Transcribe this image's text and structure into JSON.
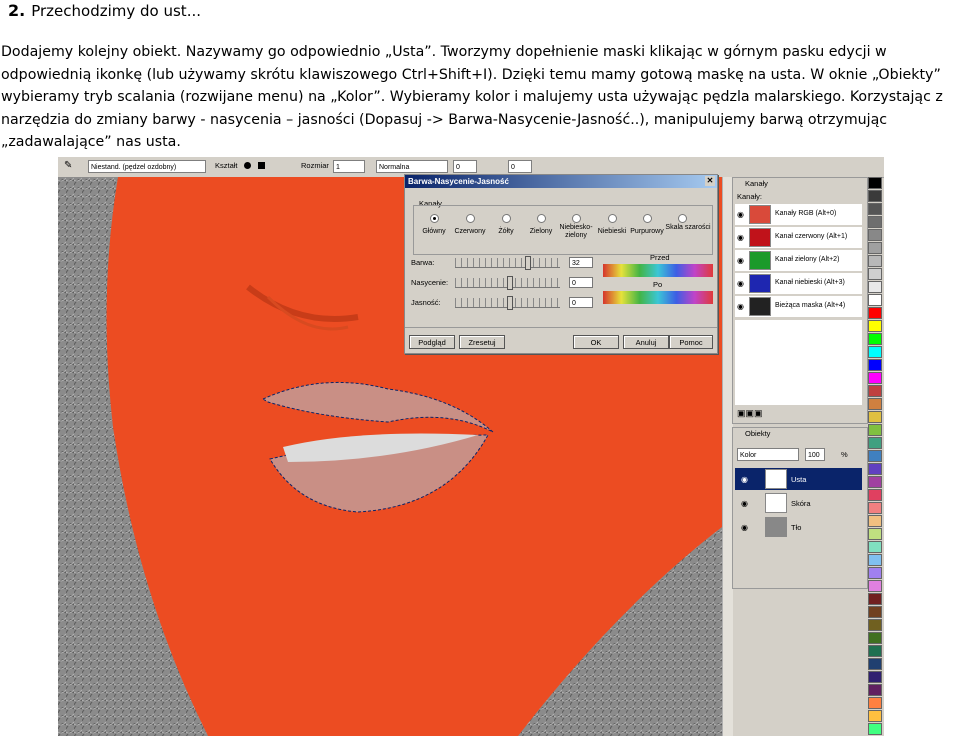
{
  "heading": {
    "number": "2.",
    "text": "Przechodzimy do ust..."
  },
  "paragraph_lines": [
    "Dodajemy kolejny obiekt. Nazywamy go odpowiednio „Usta”. Tworzymy dopełnienie maski klikając w górnym pasku edycji w",
    "odpowiednią ikonkę (lub używamy skrótu klawiszowego Ctrl+Shift+I). Dzięki temu mamy gotową maskę na usta. W oknie „Obiekty”",
    "wybieramy tryb scalania (rozwijane menu) na „Kolor”. Wybieramy kolor i malujemy usta używając pędzla malarskiego. Korzystając z",
    "narzędzia do zmiany barwy - nasycenia – jasności (Dopasuj -> Barwa-Nasycenie-Jasność..), manipulujemy barwą otrzymując",
    "„zadawalające” nas usta."
  ],
  "toolbar": {
    "brush": "Niestand. (pędzel ozdobny)",
    "shape_label": "Kształt",
    "size_label": "Rozmiar",
    "size_value": "1",
    "blend_mode": "Normalna",
    "value_a": "0",
    "value_b": "0"
  },
  "dialog": {
    "title": "Barwa-Nasycenie-Jasność",
    "group_label": "Kanały",
    "channels": [
      "Główny",
      "Czerwony",
      "Żółty",
      "Zielony",
      "Niebiesko-zielony",
      "Niebieski",
      "Purpurowy",
      "Skala szarości"
    ],
    "selected_channel": "Główny",
    "hue_label": "Barwa:",
    "hue_value": "32",
    "sat_label": "Nasycenie:",
    "sat_value": "0",
    "light_label": "Jasność:",
    "light_value": "0",
    "before_label": "Przed",
    "after_label": "Po",
    "buttons": {
      "preview": "Podgląd",
      "reset": "Zresetuj",
      "ok": "OK",
      "cancel": "Anuluj",
      "help": "Pomoc"
    }
  },
  "channels_panel": {
    "title": "Kanały",
    "subtitle": "Kanały:",
    "rows": [
      {
        "label": "Kanały RGB (Alt+0)",
        "color": "#d94a3a"
      },
      {
        "label": "Kanał czerwony (Alt+1)",
        "color": "#c0121a"
      },
      {
        "label": "Kanał zielony (Alt+2)",
        "color": "#1b9a2a"
      },
      {
        "label": "Kanał niebieski (Alt+3)",
        "color": "#1e26b0"
      },
      {
        "label": "Bieżąca maska (Alt+4)",
        "color": "#222222"
      }
    ]
  },
  "objects_panel": {
    "title": "Obiekty",
    "mode": "Kolor",
    "opacity": "100",
    "opacity_unit": "%",
    "rows": [
      {
        "label": "Usta",
        "selected": true
      },
      {
        "label": "Skóra",
        "selected": false
      },
      {
        "label": "Tło",
        "selected": false
      }
    ]
  },
  "colors": {
    "canvas_orange": "#ec4c22",
    "lips": "#c98f85",
    "hair": "#8a8a8a",
    "selection": "#0a246a"
  },
  "palette": [
    "#000000",
    "#3a3a3a",
    "#555555",
    "#6e6e6e",
    "#888888",
    "#a0a0a0",
    "#b8b8b8",
    "#d0d0d0",
    "#e8e8e8",
    "#ffffff",
    "#ff0000",
    "#ffff00",
    "#00ff00",
    "#00ffff",
    "#0000ff",
    "#ff00ff",
    "#c04040",
    "#d08040",
    "#e0c040",
    "#80c040",
    "#40a080",
    "#4080c0",
    "#6040c0",
    "#a040a0",
    "#e04060",
    "#f08080",
    "#f0c080",
    "#c0e080",
    "#80e0c0",
    "#80c0f0",
    "#a080f0",
    "#e080e0",
    "#702020",
    "#704020",
    "#706020",
    "#407020",
    "#207050",
    "#204070",
    "#302070",
    "#602060",
    "#ff8040",
    "#ffc040",
    "#40ff80",
    "#40c0ff"
  ]
}
